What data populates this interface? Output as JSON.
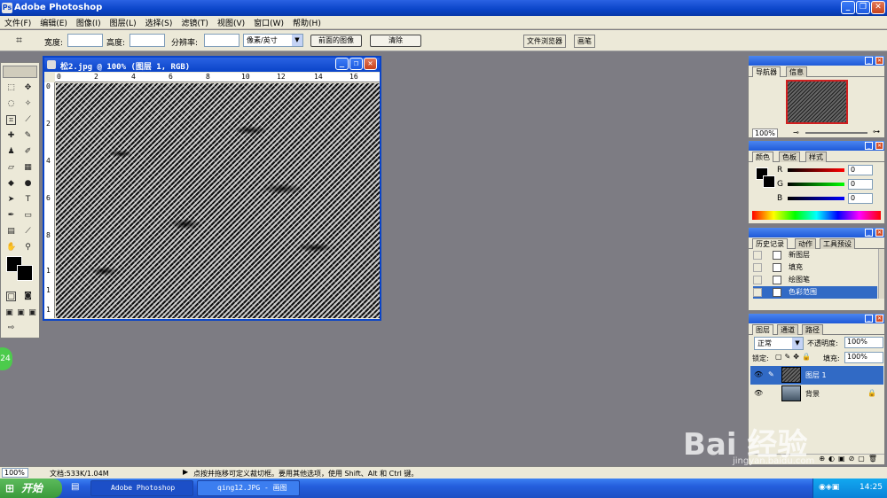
{
  "app": {
    "title": "Adobe Photoshop",
    "icon": "ps-icon"
  },
  "menu": [
    "文件(F)",
    "编辑(E)",
    "图像(I)",
    "图层(L)",
    "选择(S)",
    "滤镜(T)",
    "视图(V)",
    "窗口(W)",
    "帮助(H)"
  ],
  "options": {
    "width_label": "宽度:",
    "height_label": "高度:",
    "res_label": "分辨率:",
    "unit": "像素/英寸",
    "front_image": "前面的图像",
    "clear": "清除",
    "tab_browser": "文件浏览器",
    "tab_brushes": "画笔"
  },
  "document": {
    "title": "松2.jpg @ 100% (图层 1, RGB)",
    "ruler_h": [
      "0",
      "2",
      "4",
      "6",
      "8",
      "10",
      "12",
      "14",
      "16"
    ],
    "ruler_v": [
      "0",
      "2",
      "4",
      "6",
      "8",
      "1",
      "1",
      "1"
    ]
  },
  "navigator": {
    "tabs": [
      "导航器",
      "信息"
    ],
    "zoom": "100%"
  },
  "color": {
    "tabs": [
      "颜色",
      "色板",
      "样式"
    ],
    "r_label": "R",
    "g_label": "G",
    "b_label": "B",
    "r": "0",
    "g": "0",
    "b": "0"
  },
  "history": {
    "tabs": [
      "历史记录",
      "动作",
      "工具预设"
    ],
    "items": [
      "新图层",
      "填充",
      "绘图笔",
      "色彩范围"
    ]
  },
  "layers": {
    "tabs": [
      "图层",
      "通道",
      "路径"
    ],
    "blend": "正常",
    "opacity_label": "不透明度:",
    "opacity": "100%",
    "lock_label": "锁定:",
    "fill_label": "填充:",
    "fill": "100%",
    "items": [
      "图层 1",
      "背景"
    ]
  },
  "status": {
    "zoom": "100%",
    "doc": "文档:533K/1.04M",
    "hint": "点按并拖移可定义裁切框。要用其他选项，使用 Shift、Alt 和 Ctrl 键。"
  },
  "taskbar": {
    "start": "开始",
    "tasks": [
      "Adobe Photoshop",
      "qing12.JPG - 画图"
    ],
    "time": "14:25"
  },
  "watermark": {
    "logo": "Bai 经验",
    "url": "jingyan.baidu.com"
  },
  "badge": "24"
}
